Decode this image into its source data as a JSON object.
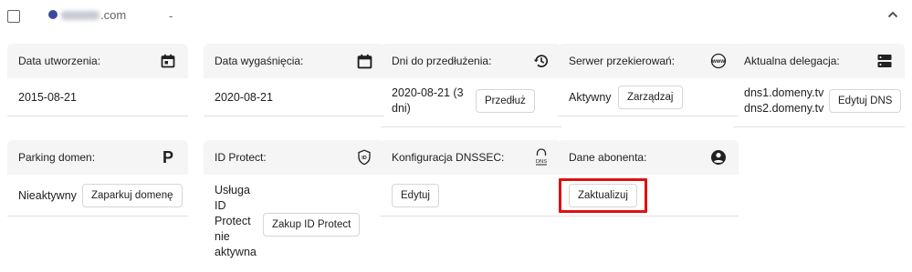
{
  "domain": {
    "tld": ".com",
    "dash": "-"
  },
  "cards": {
    "creation": {
      "title": "Data utworzenia:",
      "value": "2015-08-21"
    },
    "expiry": {
      "title": "Data wygaśnięcia:",
      "value": "2020-08-21"
    },
    "renewal": {
      "title": "Dni do przedłużenia:",
      "value_line1": "2020-08-21 (3",
      "value_line2": "dni)",
      "button": "Przedłuż"
    },
    "redirect": {
      "title": "Serwer przekierowań:",
      "value": "Aktywny",
      "button": "Zarządzaj"
    },
    "delegation": {
      "title": "Aktualna delegacja:",
      "dns1": "dns1.domeny.tv",
      "dns2": "dns2.domeny.tv",
      "button": "Edytuj DNS"
    },
    "parking": {
      "title": "Parking domen:",
      "value": "Nieaktywny",
      "button": "Zaparkuj domenę",
      "icon_glyph": "P"
    },
    "idprotect": {
      "title": "ID Protect:",
      "value_lines": [
        "Usługa",
        "ID",
        "Protect",
        "nie",
        "aktywna"
      ],
      "button": "Zakup ID Protect",
      "icon_label": "ID"
    },
    "dnssec": {
      "title": "Konfiguracja DNSSEC:",
      "button": "Edytuj",
      "icon_label": "DNS"
    },
    "subscriber": {
      "title": "Dane abonenta:",
      "button": "Zaktualizuj"
    }
  },
  "colors": {
    "card_header": "#f5f5f5",
    "highlight": "#e01010",
    "divider": "#e0e0e0"
  },
  "icons": [
    "checkbox",
    "favicon",
    "chevron-up-icon",
    "calendar-today-icon",
    "calendar-icon",
    "history-icon",
    "www-icon",
    "dns-server-icon",
    "parking-icon",
    "id-protect-icon",
    "dnssec-icon",
    "account-circle-icon"
  ]
}
